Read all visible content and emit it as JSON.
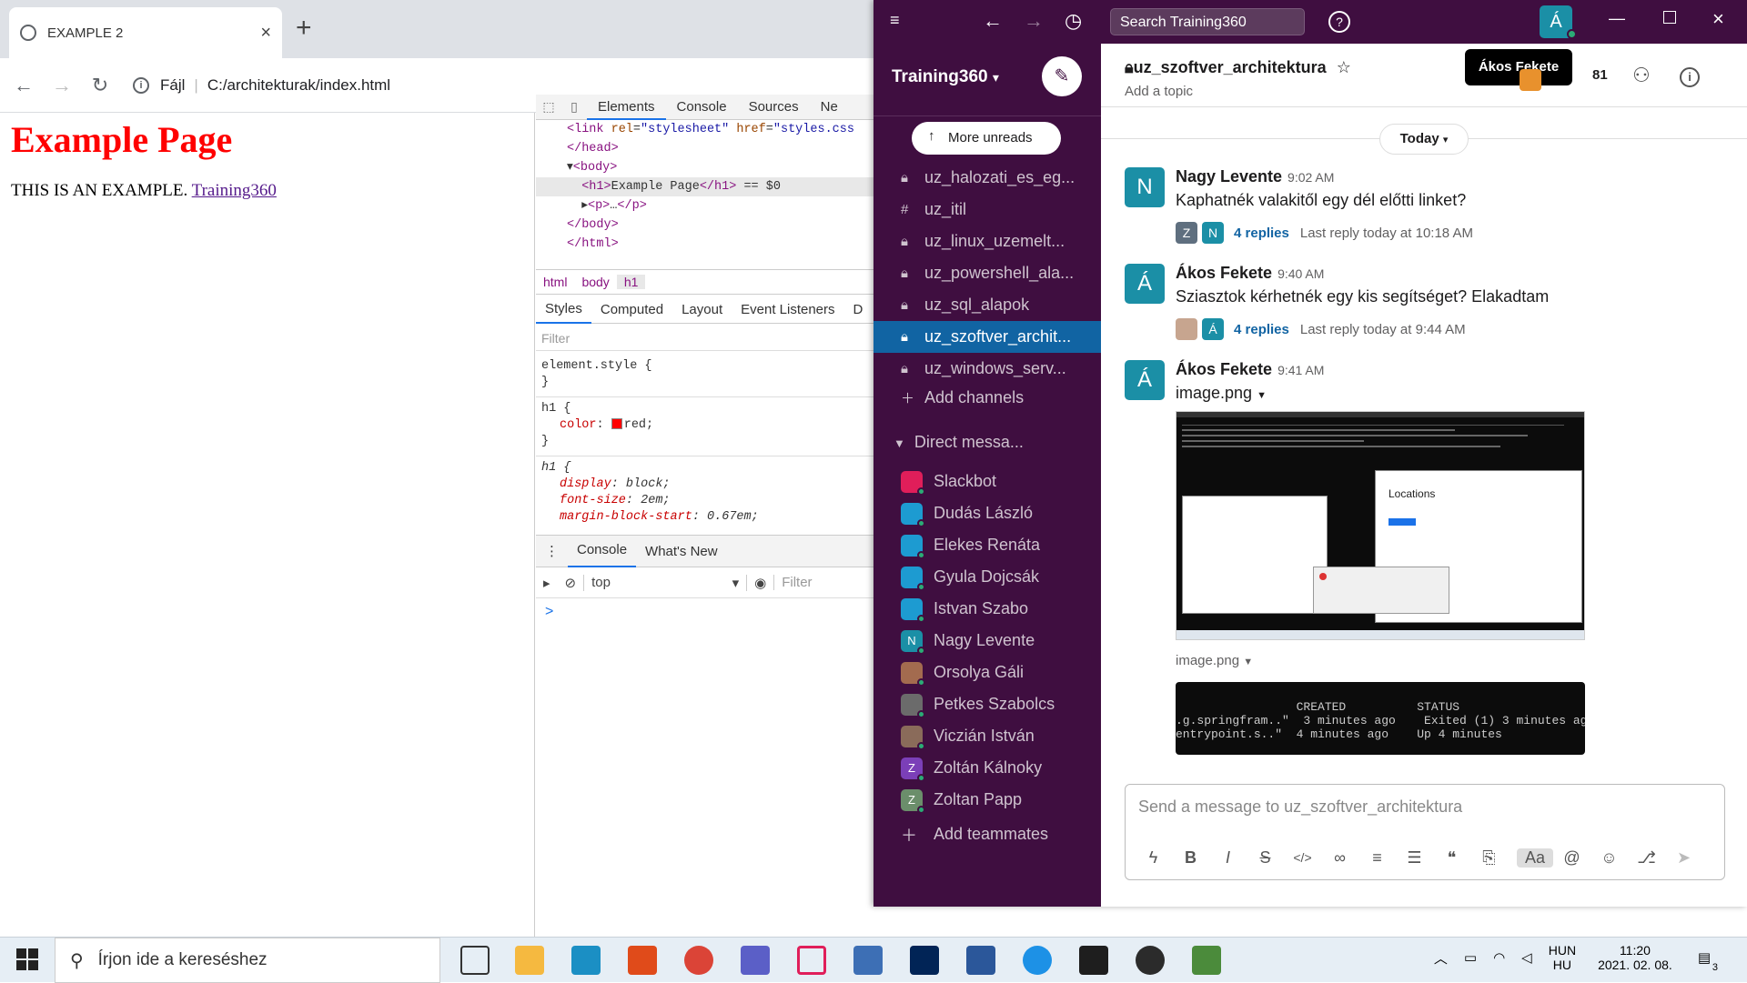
{
  "chrome": {
    "tab_title": "EXAMPLE 2",
    "tab_close": "×",
    "new_tab": "+",
    "omnibox_scheme": "Fájl",
    "omnibox_url": "C:/architekturak/index.html"
  },
  "page": {
    "heading": "Example Page",
    "paragraph": "THIS IS AN EXAMPLE.",
    "link": "Training360"
  },
  "devtools": {
    "tabs": [
      "Elements",
      "Console",
      "Sources",
      "Ne"
    ],
    "crumbs": [
      "html",
      "body",
      "h1"
    ],
    "style_tabs": [
      "Styles",
      "Computed",
      "Layout",
      "Event Listeners",
      "D"
    ],
    "filter_placeholder": "Filter",
    "drawer_tabs": [
      "Console",
      "What's New"
    ],
    "console_context": "top",
    "console_filter": "Filter",
    "prompt": ">"
  },
  "slack": {
    "search_placeholder": "Search Training360",
    "user_initial": "Á",
    "workspace": "Training360",
    "more_unreads": "More unreads",
    "channels": [
      {
        "name": "uz_halozati_es_eg...",
        "type": "lock"
      },
      {
        "name": "uz_itil",
        "type": "hash"
      },
      {
        "name": "uz_linux_uzemelt...",
        "type": "lock"
      },
      {
        "name": "uz_powershell_ala...",
        "type": "lock"
      },
      {
        "name": "uz_sql_alapok",
        "type": "lock"
      },
      {
        "name": "uz_szoftver_archit...",
        "type": "lock",
        "active": true
      },
      {
        "name": "uz_windows_serv...",
        "type": "lock"
      }
    ],
    "add_channels": "Add channels",
    "dm_header": "Direct messa...",
    "dms": [
      {
        "name": "Slackbot",
        "color": "#e01e5a"
      },
      {
        "name": "Dudás László",
        "color": "#1d9bd1"
      },
      {
        "name": "Elekes Renáta",
        "color": "#1d9bd1"
      },
      {
        "name": "Gyula Dojcsák",
        "color": "#1d9bd1"
      },
      {
        "name": "Istvan Szabo",
        "color": "#1d9bd1"
      },
      {
        "name": "Nagy Levente",
        "color": "#1b8fa6",
        "initial": "N"
      },
      {
        "name": "Orsolya Gáli",
        "color": "#a36b4f"
      },
      {
        "name": "Petkes Szabolcs",
        "color": "#6b6b6b"
      },
      {
        "name": "Viczián István",
        "color": "#8a6b5a"
      },
      {
        "name": "Zoltán Kálnoky",
        "color": "#7b3fb8",
        "initial": "Z"
      },
      {
        "name": "Zoltan Papp",
        "color": "#6b8e6b",
        "initial": "Z"
      }
    ],
    "add_teammates": "Add teammates",
    "channel_name": "uz_szoftver_architektura",
    "topic": "Add a topic",
    "tooltip": "Ákos Fekete",
    "member_count": "81",
    "today": "Today",
    "messages": [
      {
        "initial": "N",
        "author": "Nagy Levente",
        "time": "9:02 AM",
        "text": "Kaphatnék valakitől egy dél előtti linket?",
        "replies": "4 replies",
        "last": "Last reply today at 10:18 AM",
        "avatars": [
          "Z",
          "N"
        ]
      },
      {
        "initial": "Á",
        "author": "Ákos Fekete",
        "time": "9:40 AM",
        "text": "Sziasztok kérhetnék egy kis segítséget? Elakadtam",
        "replies": "4 replies",
        "last": "Last reply today at 9:44 AM",
        "avatars": [
          "",
          "Á"
        ]
      },
      {
        "initial": "Á",
        "author": "Ákos Fekete",
        "time": "9:41 AM",
        "text": ""
      }
    ],
    "image_label_1": "image.png",
    "image_label_2": "image.png",
    "image1_window_title": "Locations",
    "image2_text": "                 CREATED          STATUS\n.g.springfram..\"  3 minutes ago    Exited (1) 3 minutes ago\nentrypoint.s..\"  4 minutes ago    Up 4 minutes",
    "composer_placeholder": "Send a message to  uz_szoftver_architektura"
  },
  "taskbar": {
    "search_placeholder": "Írjon ide a kereséshez",
    "lang_top": "HUN",
    "lang_bottom": "HU",
    "time": "11:20",
    "date": "2021. 02. 08.",
    "notif_count": "3"
  }
}
